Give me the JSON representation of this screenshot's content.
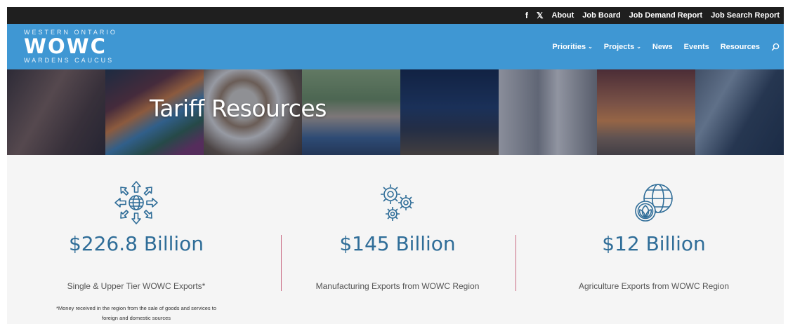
{
  "topbar": {
    "social": [
      "f",
      "𝕏"
    ],
    "links": [
      "About",
      "Job Board",
      "Job Demand Report",
      "Job Search Report"
    ]
  },
  "logo": {
    "line1": "WESTERN ONTARIO",
    "line2": "WOWC",
    "line3": "WARDENS CAUCUS"
  },
  "nav": {
    "items": [
      {
        "label": "Priorities",
        "dropdown": true
      },
      {
        "label": "Projects",
        "dropdown": true
      },
      {
        "label": "News",
        "dropdown": false
      },
      {
        "label": "Events",
        "dropdown": false
      },
      {
        "label": "Resources",
        "dropdown": false
      }
    ],
    "dropdown_glyph": "⌄"
  },
  "hero": {
    "title": "Tariff Resources"
  },
  "stats": [
    {
      "icon": "globe-arrows-icon",
      "value": "$226.8 Billion",
      "label": "Single & Upper Tier WOWC Exports*",
      "note_line1": "*Money received in the region from the sale of goods and services to",
      "note_line2": "foreign and domestic sources"
    },
    {
      "icon": "gears-icon",
      "value": "$145 Billion",
      "label": "Manufacturing Exports from WOWC Region"
    },
    {
      "icon": "globe-leaf-icon",
      "value": "$12 Billion",
      "label": "Agriculture Exports from WOWC Region"
    }
  ],
  "colors": {
    "topbar": "#1f1f1f",
    "nav": "#3f97d3",
    "stat_value": "#2f6d98",
    "divider": "#c96a83",
    "background": "#f5f5f5"
  }
}
